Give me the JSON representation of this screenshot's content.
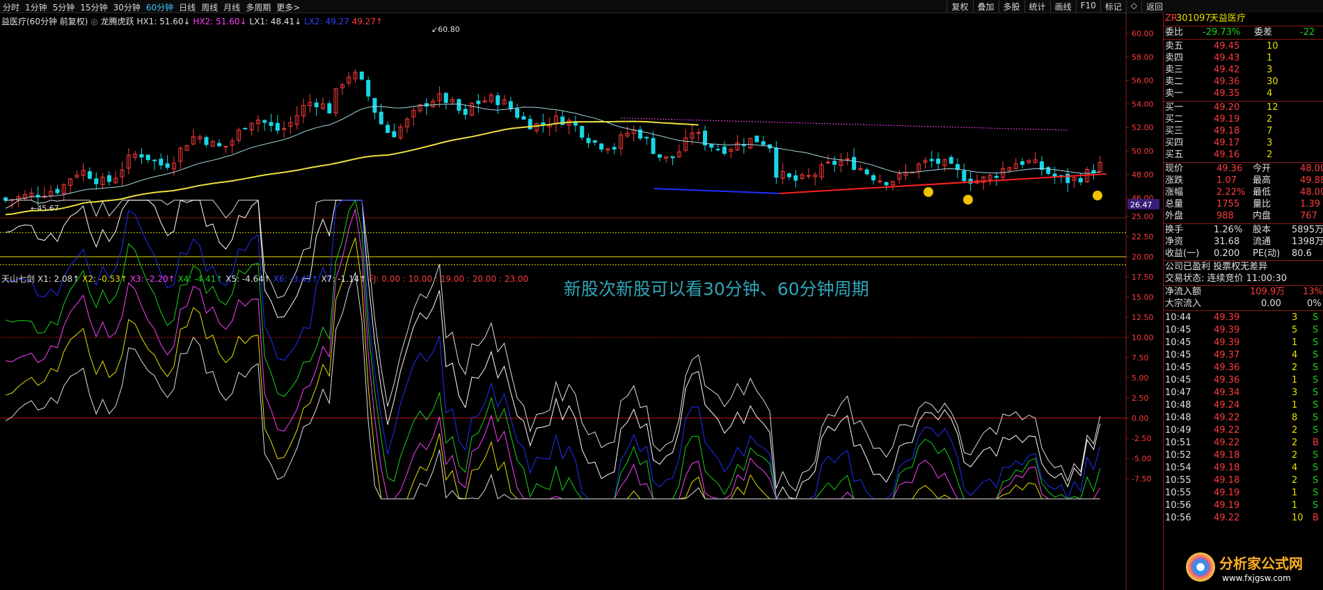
{
  "toolbar": {
    "periods": [
      "分时",
      "1分钟",
      "5分钟",
      "15分钟",
      "30分钟",
      "60分钟",
      "日线",
      "周线",
      "月线",
      "多周期",
      "更多>"
    ],
    "active_period": "60分钟",
    "right_buttons": [
      "复权",
      "叠加",
      "多股",
      "统计",
      "画线",
      "F10",
      "标记",
      "◇",
      "返回"
    ]
  },
  "main_info": {
    "stock": "益医疗(60分钟 前复权)",
    "indicator": "龙腾虎跃",
    "hx1": "HX1: 51.60↓",
    "hx2": "HX2: 51.60↓",
    "lx1": "LX1: 48.41↓",
    "lx2": "LX2: 49.27",
    "lx3": "49.27↑"
  },
  "price_axis": [
    "60.00",
    "58.00",
    "56.00",
    "54.00",
    "52.00",
    "50.00",
    "48.00",
    "46.00"
  ],
  "price_marks": {
    "high": "60.80",
    "low": "45.67"
  },
  "sub_info": {
    "name": "天山七剑",
    "x1": "X1: 2.08↑",
    "x2": "X2: -0.53↑",
    "x3": "X3: -2.20↑",
    "x4": "X4: -4.41↑",
    "x5": "X5: -4.64↑",
    "x6": "X6: -3.45↑",
    "x7": "X7: -1.14↑",
    "fj": "FJ: 0.00 : 10.00 : 19.00 : 20.00 : 23.00"
  },
  "sub_axis": [
    "25.00",
    "22.50",
    "20.00",
    "17.50",
    "15.00",
    "12.50",
    "10.00",
    "7.50",
    "5.00",
    "2.50",
    "0.00",
    "-2.50",
    "-5.00",
    "-7.50"
  ],
  "sub_top_value": "26.47",
  "annotation": "新股次新股可以看30分钟、60分钟周期",
  "panel": {
    "header": {
      "code": "301097",
      "name": "天益医疗",
      "tag": "ZR"
    },
    "weibi": {
      "label": "委比",
      "value": "-29.73%",
      "label2": "委差",
      "value2": "-22"
    },
    "sells": [
      {
        "label": "卖五",
        "price": "49.45",
        "vol": "10"
      },
      {
        "label": "卖四",
        "price": "49.43",
        "vol": "1"
      },
      {
        "label": "卖三",
        "price": "49.42",
        "vol": "3"
      },
      {
        "label": "卖二",
        "price": "49.36",
        "vol": "30"
      },
      {
        "label": "卖一",
        "price": "49.35",
        "vol": "4"
      }
    ],
    "buys": [
      {
        "label": "买一",
        "price": "49.20",
        "vol": "12"
      },
      {
        "label": "买二",
        "price": "49.19",
        "vol": "2"
      },
      {
        "label": "买三",
        "price": "49.18",
        "vol": "7"
      },
      {
        "label": "买四",
        "price": "49.17",
        "vol": "3"
      },
      {
        "label": "买五",
        "price": "49.16",
        "vol": "2"
      }
    ],
    "stats": [
      {
        "l1": "现价",
        "v1": "49.36",
        "l2": "今开",
        "v2": "48.00"
      },
      {
        "l1": "涨跌",
        "v1": "1.07",
        "l2": "最高",
        "v2": "49.88"
      },
      {
        "l1": "涨幅",
        "v1": "2.22%",
        "l2": "最低",
        "v2": "48.00"
      },
      {
        "l1": "总量",
        "v1": "1755",
        "l2": "量比",
        "v2": "1.39"
      },
      {
        "l1": "外盘",
        "v1": "988",
        "l2": "内盘",
        "v2": "767"
      }
    ],
    "stats2": [
      {
        "l1": "换手",
        "v1": "1.26%",
        "l2": "股本",
        "v2": "5895万"
      },
      {
        "l1": "净资",
        "v1": "31.68",
        "l2": "流通",
        "v2": "1398万"
      },
      {
        "l1": "收益(一)",
        "v1": "0.200",
        "l2": "PE(动)",
        "v2": "80.6"
      }
    ],
    "notice": "公司已盈利 投票权无差异",
    "trade_state": "交易状态: 连续竞价 11:00:30",
    "netflow": {
      "label": "净流入额",
      "value": "109.9万",
      "pct": "13%"
    },
    "bigflow": {
      "label": "大宗流入",
      "value": "0.00",
      "pct": "0%"
    },
    "ticks": [
      {
        "t": "10:44",
        "p": "49.39",
        "v": "3",
        "d": "S"
      },
      {
        "t": "10:45",
        "p": "49.39",
        "v": "5",
        "d": "S"
      },
      {
        "t": "10:45",
        "p": "49.39",
        "v": "1",
        "d": "S"
      },
      {
        "t": "10:45",
        "p": "49.37",
        "v": "4",
        "d": "S"
      },
      {
        "t": "10:45",
        "p": "49.36",
        "v": "2",
        "d": "S"
      },
      {
        "t": "10:45",
        "p": "49.36",
        "v": "1",
        "d": "S"
      },
      {
        "t": "10:47",
        "p": "49.34",
        "v": "3",
        "d": "S"
      },
      {
        "t": "10:48",
        "p": "49.24",
        "v": "1",
        "d": "S"
      },
      {
        "t": "10:48",
        "p": "49.22",
        "v": "8",
        "d": "S"
      },
      {
        "t": "10:49",
        "p": "49.22",
        "v": "2",
        "d": "S"
      },
      {
        "t": "10:51",
        "p": "49.22",
        "v": "2",
        "d": "B"
      },
      {
        "t": "10:52",
        "p": "49.18",
        "v": "2",
        "d": "S"
      },
      {
        "t": "10:54",
        "p": "49.18",
        "v": "4",
        "d": "S"
      },
      {
        "t": "10:55",
        "p": "49.18",
        "v": "2",
        "d": "S"
      },
      {
        "t": "10:55",
        "p": "49.19",
        "v": "1",
        "d": "S"
      },
      {
        "t": "10:56",
        "p": "49.19",
        "v": "1",
        "d": "S"
      },
      {
        "t": "10:56",
        "p": "49.22",
        "v": "10",
        "d": "B"
      }
    ]
  },
  "watermark": {
    "name": "分析家公式网",
    "url": "www.fxjgsw.com"
  },
  "colors": {
    "up": "#ff3b3b",
    "down": "#19d6e6",
    "accent": "#3ec7ff",
    "ma1": "#9fd8e0",
    "ma2": "#f0e040",
    "ma3": "#ff40ff"
  }
}
